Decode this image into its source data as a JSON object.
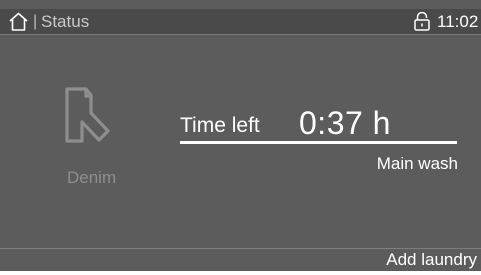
{
  "status_bar": {
    "separator": "|",
    "title": "Status",
    "clock": "11:02",
    "icons": {
      "home": "home-icon",
      "lock": "lock-open-icon"
    }
  },
  "program": {
    "name": "Denim",
    "icon": "denim-jeans-icon"
  },
  "time": {
    "label": "Time left",
    "value": "0:37 h",
    "progress": 1.0
  },
  "phase": "Main wash",
  "actions": {
    "add_laundry": "Add laundry"
  },
  "colors": {
    "background": "#5c5c5c",
    "status_bar": "#4a4a4a",
    "text_primary": "#ffffff",
    "text_muted": "#8e8e8e"
  }
}
